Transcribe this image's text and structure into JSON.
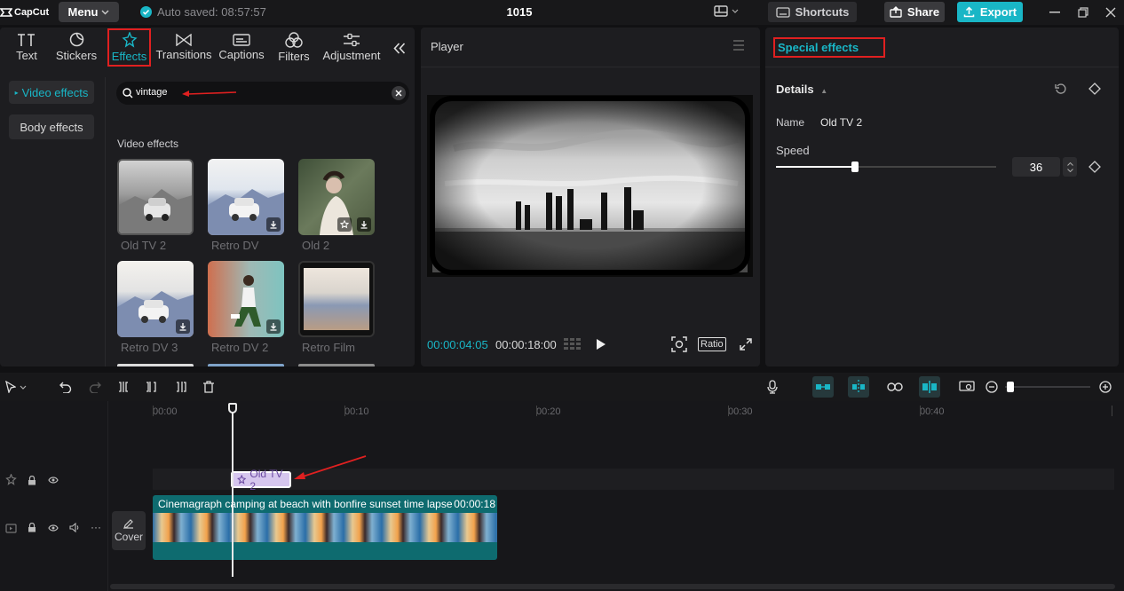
{
  "app": {
    "logo_text": "CapCut",
    "menu_label": "Menu",
    "autosave": "Auto saved: 08:57:57",
    "project_title": "1015"
  },
  "topbar": {
    "shortcuts_label": "Shortcuts",
    "share_label": "Share",
    "export_label": "Export"
  },
  "tabs": [
    {
      "label": "Text",
      "icon": "text-icon"
    },
    {
      "label": "Stickers",
      "icon": "sticker-icon"
    },
    {
      "label": "Effects",
      "icon": "effects-icon"
    },
    {
      "label": "Transitions",
      "icon": "transitions-icon"
    },
    {
      "label": "Captions",
      "icon": "captions-icon"
    },
    {
      "label": "Filters",
      "icon": "filters-icon"
    },
    {
      "label": "Adjustment",
      "icon": "adjustment-icon"
    }
  ],
  "categories": {
    "video_effects": "Video effects",
    "body_effects": "Body effects"
  },
  "search": {
    "value": "vintage"
  },
  "effects_section": {
    "title": "Video effects",
    "items": [
      {
        "label": "Old TV 2"
      },
      {
        "label": "Retro DV"
      },
      {
        "label": "Old 2"
      },
      {
        "label": "Retro DV 3"
      },
      {
        "label": "Retro DV 2"
      },
      {
        "label": "Retro Film"
      }
    ]
  },
  "player": {
    "title": "Player",
    "current_time": "00:00:04:05",
    "total_time": "00:00:18:00",
    "ratio_label": "Ratio"
  },
  "inspector": {
    "title": "Special effects",
    "details_label": "Details",
    "name_label": "Name",
    "name_value": "Old TV 2",
    "speed_label": "Speed",
    "speed_value": "36",
    "speed_fraction": 0.36
  },
  "timeline": {
    "ruler": [
      "00:00",
      "00:10",
      "00:20",
      "00:30",
      "00:40"
    ],
    "effect_clip_label": "Old TV 2",
    "video_clip_title": "Cinemagraph camping at beach with bonfire sunset time lapse",
    "video_clip_duration": "00:00:18",
    "cover_label": "Cover"
  },
  "colors": {
    "accent": "#19b6c6",
    "highlight": "#e02020",
    "effect_clip": "#d6c6ee"
  }
}
